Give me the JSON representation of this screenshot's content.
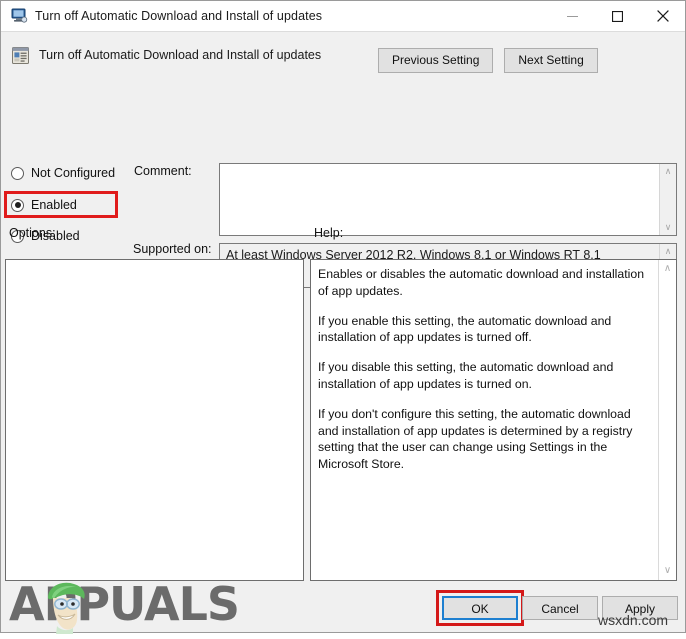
{
  "window": {
    "title": "Turn off Automatic Download and Install of updates",
    "title_icon": "computer-monitor-icon",
    "controls": {
      "minimize": "minimize-icon",
      "maximize": "maximize-icon",
      "close": "close-icon"
    }
  },
  "header": {
    "icon": "group-policy-setting-icon",
    "title": "Turn off Automatic Download and Install of updates",
    "previous_setting": "Previous Setting",
    "next_setting": "Next Setting"
  },
  "state_options": {
    "not_configured": "Not Configured",
    "enabled": "Enabled",
    "disabled": "Disabled",
    "selected": "Enabled",
    "highlight_color": "#e01b1b"
  },
  "comment": {
    "label": "Comment:",
    "value": "",
    "scroll_up": "∧",
    "scroll_down": "∨"
  },
  "supported_on": {
    "label": "Supported on:",
    "value": "At least Windows Server 2012 R2, Windows 8.1 or Windows RT 8.1",
    "scroll_up": "∧",
    "scroll_down": "∨"
  },
  "options": {
    "label": "Options:",
    "content": ""
  },
  "help": {
    "label": "Help:",
    "paragraphs": [
      "Enables or disables the automatic download and installation of app updates.",
      "If you enable this setting, the automatic download and installation of app updates is turned off.",
      "If you disable this setting, the automatic download and installation of app updates is turned on.",
      "If you don't configure this setting, the automatic download and installation of app updates is determined by a registry setting that the user can change using Settings in the Microsoft Store."
    ],
    "scroll_up": "∧",
    "scroll_down": "∨"
  },
  "buttons": {
    "ok": "OK",
    "cancel": "Cancel",
    "apply": "Apply",
    "ok_focus_color": "#1d7fd0",
    "ok_highlight_color": "#d41919"
  },
  "watermarks": {
    "brand": "APPUALS",
    "site": "wsxdn.com"
  }
}
